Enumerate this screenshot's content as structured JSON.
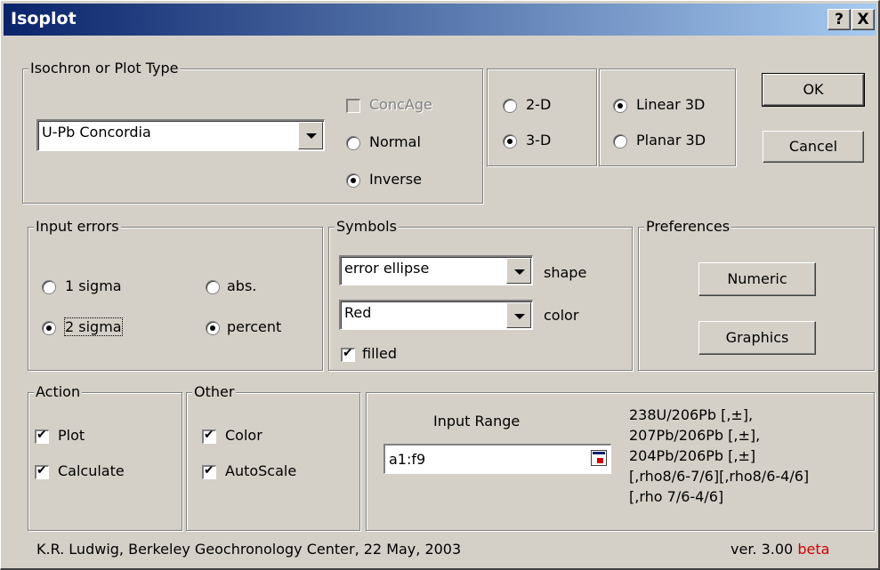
{
  "window": {
    "title": "Isoplot",
    "help_label": "?",
    "close_label": "X"
  },
  "plot_type": {
    "group_label": "Isochron or Plot Type",
    "selected": "U-Pb Concordia",
    "concage_label": "ConcAge",
    "normal_label": "Normal",
    "inverse_label": "Inverse",
    "inverse_selected": true
  },
  "dimension": {
    "d2_label": "2-D",
    "d3_label": "3-D",
    "selected": "3-D"
  },
  "mode3d": {
    "linear_label": "Linear 3D",
    "planar_label": "Planar 3D",
    "selected": "Linear 3D"
  },
  "buttons": {
    "ok": "OK",
    "cancel": "Cancel",
    "numeric": "Numeric",
    "graphics": "Graphics"
  },
  "input_errors": {
    "group_label": "Input errors",
    "sigma1_label": "1 sigma",
    "sigma2_label": "2 sigma",
    "abs_label": "abs.",
    "percent_label": "percent",
    "sigma_selected": "2 sigma",
    "type_selected": "percent"
  },
  "symbols": {
    "group_label": "Symbols",
    "shape_value": "error ellipse",
    "shape_label": "shape",
    "color_value": "Red",
    "color_label": "color",
    "filled_label": "filled",
    "filled": true
  },
  "preferences": {
    "group_label": "Preferences"
  },
  "action": {
    "group_label": "Action",
    "plot_label": "Plot",
    "calculate_label": "Calculate",
    "plot": true,
    "calculate": true
  },
  "other": {
    "group_label": "Other",
    "color_label": "Color",
    "autoscale_label": "AutoScale",
    "color": true,
    "autoscale": true
  },
  "input_range": {
    "label": "Input Range",
    "value": "a1:f9",
    "format_lines": [
      "238U/206Pb  [,±],",
      "207Pb/206Pb  [,±],",
      "204Pb/206Pb  [,±]",
      "[,rho8/6-7/6][,rho8/6-4/6]",
      "[,rho 7/6-4/6]"
    ]
  },
  "footer": {
    "credit": "K.R. Ludwig, Berkeley Geochronology Center,  22 May, 2003",
    "version": "ver. 3.00",
    "beta": "beta",
    "beta_color": "#cc0000"
  }
}
